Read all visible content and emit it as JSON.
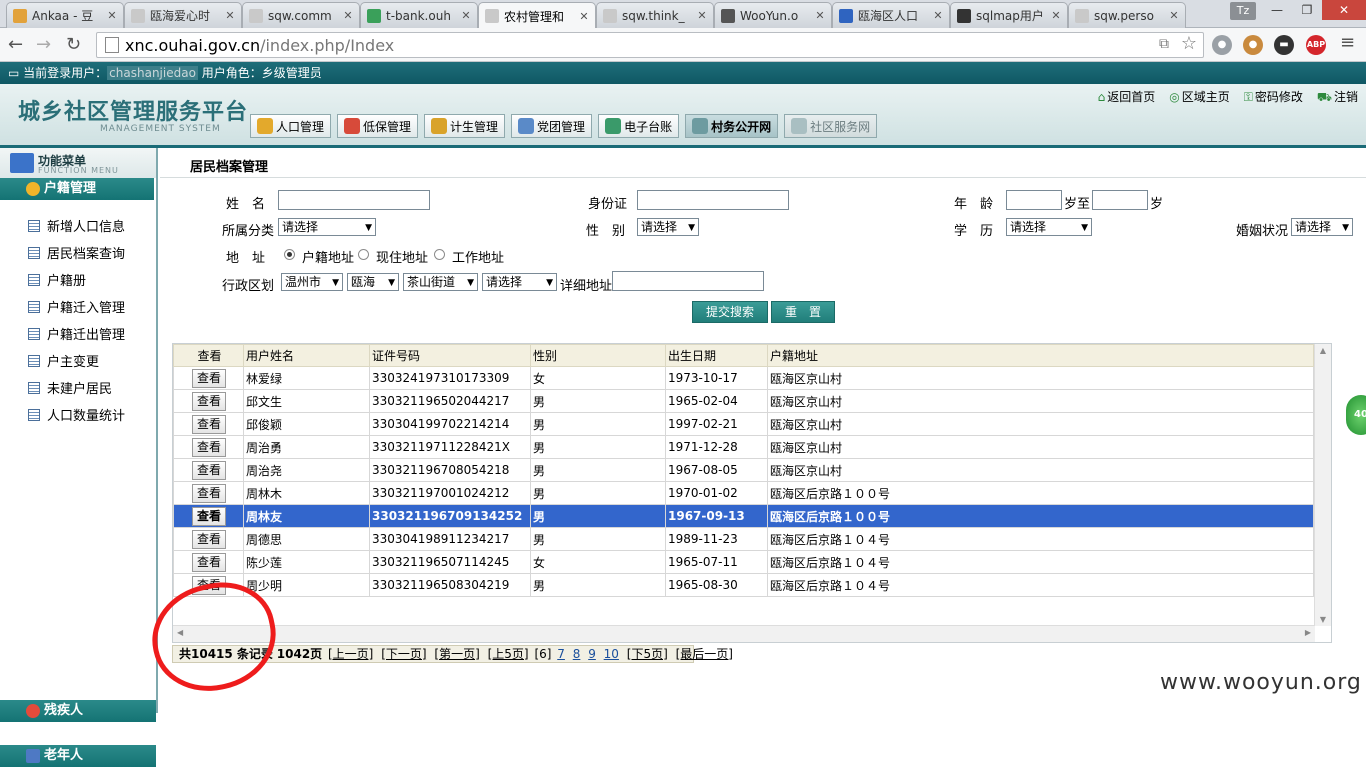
{
  "browser": {
    "tabs": [
      {
        "title": "Ankaa - 豆",
        "color": "#e2a23b"
      },
      {
        "title": "瓯海爱心时",
        "color": "#c9c9c9"
      },
      {
        "title": "sqw.comm",
        "color": "#c9c9c9"
      },
      {
        "title": "t-bank.ouh",
        "color": "#3aa05a"
      },
      {
        "title": "农村管理和",
        "color": "#c9c9c9"
      },
      {
        "title": "sqw.think_",
        "color": "#c9c9c9"
      },
      {
        "title": "WooYun.o",
        "color": "#555555"
      },
      {
        "title": "瓯海区人口",
        "color": "#2f64c0"
      },
      {
        "title": "sqlmap用户",
        "color": "#333333"
      },
      {
        "title": "sqw.perso",
        "color": "#c9c9c9"
      }
    ],
    "profile_badge": "Tz",
    "url_host": "xnc.ouhai.gov.cn",
    "url_path": "/index.php/Index",
    "abp_label": "ABP"
  },
  "userbar": {
    "prefix": "当前登录用户：",
    "username": "chashanjiedao",
    "role": "用户角色：乡级管理员"
  },
  "header": {
    "logo": "城乡社区管理服务平台",
    "logo_sub": "MANAGEMENT SYSTEM",
    "links": [
      "返回首页",
      "区域主页",
      "密码修改",
      "注销"
    ],
    "modules": [
      "人口管理",
      "低保管理",
      "计生管理",
      "党团管理",
      "电子台账",
      "村务公开网",
      "社区服务网"
    ]
  },
  "sidebar": {
    "title": "功能菜单",
    "subtitle": "FUNCTION MENU",
    "section1": "户籍管理",
    "items": [
      "新增人口信息",
      "居民档案查询",
      "户籍册",
      "户籍迁入管理",
      "户籍迁出管理",
      "户主变更",
      "未建户居民",
      "人口数量统计"
    ],
    "section2": "残疾人",
    "section3": "老年人"
  },
  "main": {
    "breadcrumb": "居民档案管理",
    "form": {
      "name_label": "姓　名",
      "id_label": "身份证",
      "age_label": "年　龄",
      "age_to": "岁至",
      "age_unit": "岁",
      "category_label": "所属分类",
      "category_value": "请选择",
      "gender_label": "性　别",
      "gender_value": "请选择",
      "edu_label": "学　历",
      "edu_value": "请选择",
      "marital_label": "婚姻状况",
      "marital_value": "请选择",
      "address_label": "地　址",
      "radio_options": [
        "户籍地址",
        "现住地址",
        "工作地址"
      ],
      "region_label": "行政区划",
      "region_values": [
        "温州市",
        "瓯海",
        "茶山街道",
        "请选择"
      ],
      "detail_label": "详细地址",
      "submit_label": "提交搜索",
      "reset_label": "重　置"
    },
    "table": {
      "headers": [
        "查看",
        "用户姓名",
        "证件号码",
        "性别",
        "出生日期",
        "户籍地址"
      ],
      "view_label": "查看",
      "rows": [
        [
          "林爱绿",
          "330324197310173309",
          "女",
          "1973-10-17",
          "瓯海区京山村"
        ],
        [
          "邱文生",
          "330321196502044217",
          "男",
          "1965-02-04",
          "瓯海区京山村"
        ],
        [
          "邱俊颖",
          "330304199702214214",
          "男",
          "1997-02-21",
          "瓯海区京山村"
        ],
        [
          "周治勇",
          "33032119711228421X",
          "男",
          "1971-12-28",
          "瓯海区京山村"
        ],
        [
          "周治尧",
          "330321196708054218",
          "男",
          "1967-08-05",
          "瓯海区京山村"
        ],
        [
          "周林木",
          "330321197001024212",
          "男",
          "1970-01-02",
          "瓯海区后京路１００号"
        ],
        [
          "周林友",
          "330321196709134252",
          "男",
          "1967-09-13",
          "瓯海区后京路１００号"
        ],
        [
          "周德思",
          "330304198911234217",
          "男",
          "1989-11-23",
          "瓯海区后京路１０４号"
        ],
        [
          "陈少莲",
          "330321196507114245",
          "女",
          "1965-07-11",
          "瓯海区后京路１０４号"
        ],
        [
          "周少明",
          "330321196508304219",
          "男",
          "1965-08-30",
          "瓯海区后京路１０４号"
        ]
      ]
    },
    "pager": {
      "total": "共10415 条记录",
      "pages": "1042页",
      "prev": "[上一页]",
      "next": "[下一页]",
      "first": "[第一页]",
      "prev5": "[上5页]",
      "current": "[6]",
      "nums": [
        "7",
        "8",
        "9",
        "10"
      ],
      "next5": "[下5页]",
      "last": "[最后一页]"
    }
  },
  "side_badge": "40",
  "watermark": "www.wooyun.org"
}
